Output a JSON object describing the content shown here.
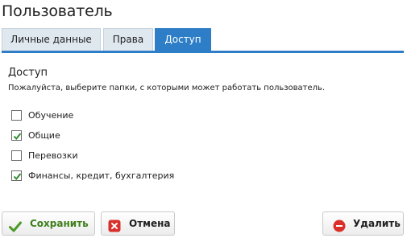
{
  "page": {
    "title": "Пользователь"
  },
  "tabs": [
    {
      "label": "Личные данные",
      "active": false
    },
    {
      "label": "Права",
      "active": false
    },
    {
      "label": "Доступ",
      "active": true
    }
  ],
  "access": {
    "heading": "Доступ",
    "description": "Пожалуйста, выберите папки, с которыми может работать пользователь.",
    "folders": [
      {
        "label": "Обучение",
        "checked": false
      },
      {
        "label": "Общие",
        "checked": true
      },
      {
        "label": "Перевозки",
        "checked": false
      },
      {
        "label": "Финансы, кредит, бухгалтерия",
        "checked": true
      }
    ]
  },
  "buttons": {
    "save": {
      "label": "Сохранить",
      "icon": "check-icon"
    },
    "cancel": {
      "label": "Отмена",
      "icon": "cancel-x-icon"
    },
    "delete": {
      "label": "Удалить",
      "icon": "minus-circle-icon"
    }
  },
  "colors": {
    "accent": "#2d7dc7",
    "tab_inactive": "#dfe7ef",
    "save_text": "#3d7f1b",
    "cancel_icon": "#d9302b",
    "delete_icon": "#d9302b",
    "check_mark": "#2f8a2f"
  }
}
